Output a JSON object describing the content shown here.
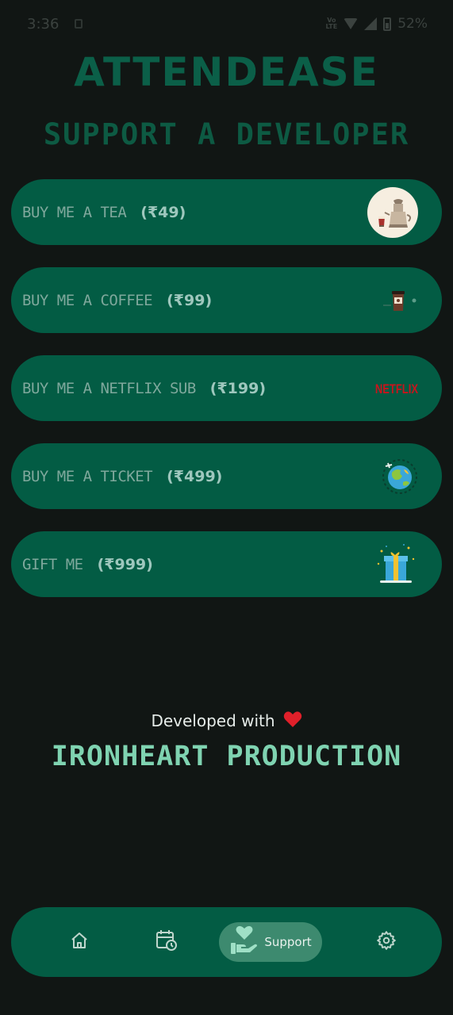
{
  "status_bar": {
    "time": "3:36",
    "lte_label": "LTE",
    "battery": "52%"
  },
  "app": {
    "title": "ATTENDEASE",
    "subtitle": "SUPPORT A DEVELOPER"
  },
  "support_options": [
    {
      "label": "BUY ME A TEA",
      "price": "(₹49)",
      "icon": "tea-pot-icon"
    },
    {
      "label": "BUY ME A COFFEE",
      "price": "(₹99)",
      "icon": "coffee-cup-icon"
    },
    {
      "label": "BUY ME A NETFLIX SUB",
      "price": "(₹199)",
      "icon": "netflix-logo",
      "logo_text": "NETFLIX"
    },
    {
      "label": "BUY ME A TICKET",
      "price": "(₹499)",
      "icon": "globe-plane-icon"
    },
    {
      "label": "GIFT ME",
      "price": "(₹999)",
      "icon": "gift-box-icon"
    }
  ],
  "footer": {
    "developed_with": "Developed with",
    "producer": "IRONHEART PRODUCTION"
  },
  "bottom_nav": {
    "items": [
      {
        "id": "home",
        "icon": "home-icon"
      },
      {
        "id": "history",
        "icon": "calendar-clock-icon"
      },
      {
        "id": "support",
        "icon": "heart-hand-icon",
        "label": "Support",
        "active": true
      },
      {
        "id": "settings",
        "icon": "gear-icon"
      }
    ]
  },
  "colors": {
    "background": "#111614",
    "card": "#035c44",
    "title": "#0b5f48",
    "accent": "#7fd3b1",
    "heart": "#e0202a"
  }
}
